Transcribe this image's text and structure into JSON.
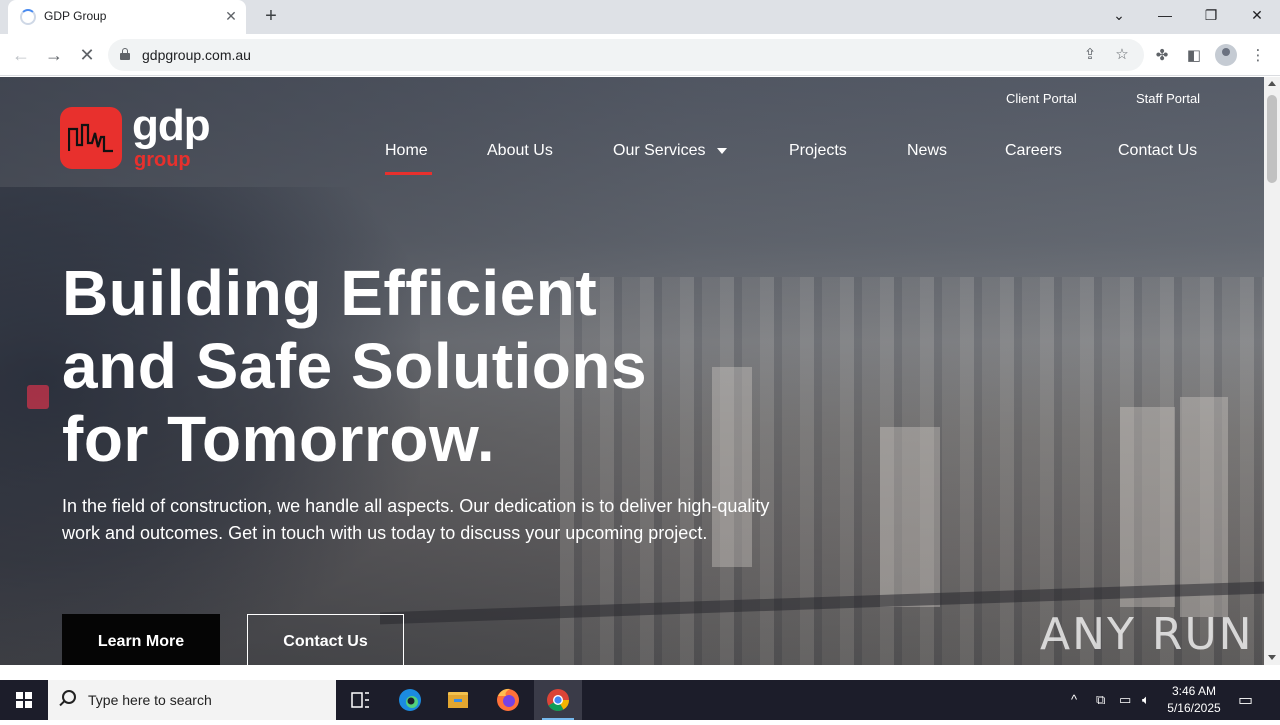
{
  "browser": {
    "tab_title": "GDP Group",
    "url": "gdpgroup.com.au"
  },
  "site": {
    "logo_text": "gdp",
    "logo_subtext": "group",
    "top_links": [
      "Client Portal",
      "Staff Portal"
    ],
    "menu": [
      "Home",
      "About Us",
      "Our Services",
      "Projects",
      "News",
      "Careers",
      "Contact Us"
    ],
    "active_menu": "Home",
    "headline_lines": [
      "Building Efficient",
      "and Safe Solutions",
      "for Tomorrow."
    ],
    "subtext": "In the field of construction, we handle all aspects. Our dedication is to deliver high-quality work and outcomes. Get in touch with us today to discuss your upcoming project.",
    "buttons": [
      "Learn More",
      "Contact Us"
    ],
    "accent_color": "#e8302d"
  },
  "watermark": "ANY RUN",
  "taskbar": {
    "search_placeholder": "Type here to search",
    "time": "3:46 AM",
    "date": "5/16/2025"
  }
}
